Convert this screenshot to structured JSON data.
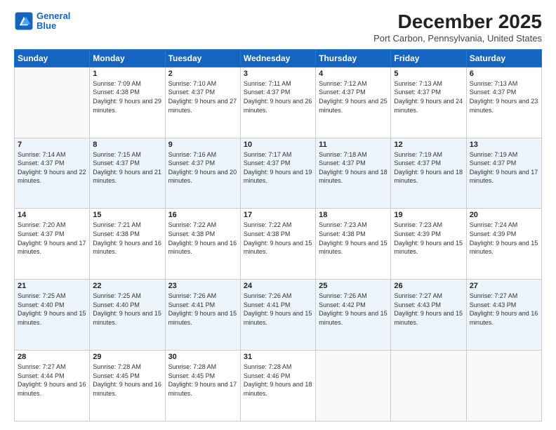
{
  "header": {
    "logo_line1": "General",
    "logo_line2": "Blue",
    "month_title": "December 2025",
    "location": "Port Carbon, Pennsylvania, United States"
  },
  "weekdays": [
    "Sunday",
    "Monday",
    "Tuesday",
    "Wednesday",
    "Thursday",
    "Friday",
    "Saturday"
  ],
  "weeks": [
    [
      {
        "day": "",
        "empty": true
      },
      {
        "day": "1",
        "sunrise": "7:09 AM",
        "sunset": "4:38 PM",
        "daylight": "9 hours and 29 minutes."
      },
      {
        "day": "2",
        "sunrise": "7:10 AM",
        "sunset": "4:37 PM",
        "daylight": "9 hours and 27 minutes."
      },
      {
        "day": "3",
        "sunrise": "7:11 AM",
        "sunset": "4:37 PM",
        "daylight": "9 hours and 26 minutes."
      },
      {
        "day": "4",
        "sunrise": "7:12 AM",
        "sunset": "4:37 PM",
        "daylight": "9 hours and 25 minutes."
      },
      {
        "day": "5",
        "sunrise": "7:13 AM",
        "sunset": "4:37 PM",
        "daylight": "9 hours and 24 minutes."
      },
      {
        "day": "6",
        "sunrise": "7:13 AM",
        "sunset": "4:37 PM",
        "daylight": "9 hours and 23 minutes."
      }
    ],
    [
      {
        "day": "7",
        "sunrise": "7:14 AM",
        "sunset": "4:37 PM",
        "daylight": "9 hours and 22 minutes."
      },
      {
        "day": "8",
        "sunrise": "7:15 AM",
        "sunset": "4:37 PM",
        "daylight": "9 hours and 21 minutes."
      },
      {
        "day": "9",
        "sunrise": "7:16 AM",
        "sunset": "4:37 PM",
        "daylight": "9 hours and 20 minutes."
      },
      {
        "day": "10",
        "sunrise": "7:17 AM",
        "sunset": "4:37 PM",
        "daylight": "9 hours and 19 minutes."
      },
      {
        "day": "11",
        "sunrise": "7:18 AM",
        "sunset": "4:37 PM",
        "daylight": "9 hours and 18 minutes."
      },
      {
        "day": "12",
        "sunrise": "7:19 AM",
        "sunset": "4:37 PM",
        "daylight": "9 hours and 18 minutes."
      },
      {
        "day": "13",
        "sunrise": "7:19 AM",
        "sunset": "4:37 PM",
        "daylight": "9 hours and 17 minutes."
      }
    ],
    [
      {
        "day": "14",
        "sunrise": "7:20 AM",
        "sunset": "4:37 PM",
        "daylight": "9 hours and 17 minutes."
      },
      {
        "day": "15",
        "sunrise": "7:21 AM",
        "sunset": "4:38 PM",
        "daylight": "9 hours and 16 minutes."
      },
      {
        "day": "16",
        "sunrise": "7:22 AM",
        "sunset": "4:38 PM",
        "daylight": "9 hours and 16 minutes."
      },
      {
        "day": "17",
        "sunrise": "7:22 AM",
        "sunset": "4:38 PM",
        "daylight": "9 hours and 15 minutes."
      },
      {
        "day": "18",
        "sunrise": "7:23 AM",
        "sunset": "4:38 PM",
        "daylight": "9 hours and 15 minutes."
      },
      {
        "day": "19",
        "sunrise": "7:23 AM",
        "sunset": "4:39 PM",
        "daylight": "9 hours and 15 minutes."
      },
      {
        "day": "20",
        "sunrise": "7:24 AM",
        "sunset": "4:39 PM",
        "daylight": "9 hours and 15 minutes."
      }
    ],
    [
      {
        "day": "21",
        "sunrise": "7:25 AM",
        "sunset": "4:40 PM",
        "daylight": "9 hours and 15 minutes."
      },
      {
        "day": "22",
        "sunrise": "7:25 AM",
        "sunset": "4:40 PM",
        "daylight": "9 hours and 15 minutes."
      },
      {
        "day": "23",
        "sunrise": "7:26 AM",
        "sunset": "4:41 PM",
        "daylight": "9 hours and 15 minutes."
      },
      {
        "day": "24",
        "sunrise": "7:26 AM",
        "sunset": "4:41 PM",
        "daylight": "9 hours and 15 minutes."
      },
      {
        "day": "25",
        "sunrise": "7:26 AM",
        "sunset": "4:42 PM",
        "daylight": "9 hours and 15 minutes."
      },
      {
        "day": "26",
        "sunrise": "7:27 AM",
        "sunset": "4:43 PM",
        "daylight": "9 hours and 15 minutes."
      },
      {
        "day": "27",
        "sunrise": "7:27 AM",
        "sunset": "4:43 PM",
        "daylight": "9 hours and 16 minutes."
      }
    ],
    [
      {
        "day": "28",
        "sunrise": "7:27 AM",
        "sunset": "4:44 PM",
        "daylight": "9 hours and 16 minutes."
      },
      {
        "day": "29",
        "sunrise": "7:28 AM",
        "sunset": "4:45 PM",
        "daylight": "9 hours and 16 minutes."
      },
      {
        "day": "30",
        "sunrise": "7:28 AM",
        "sunset": "4:45 PM",
        "daylight": "9 hours and 17 minutes."
      },
      {
        "day": "31",
        "sunrise": "7:28 AM",
        "sunset": "4:46 PM",
        "daylight": "9 hours and 18 minutes."
      },
      {
        "day": "",
        "empty": true
      },
      {
        "day": "",
        "empty": true
      },
      {
        "day": "",
        "empty": true
      }
    ]
  ]
}
